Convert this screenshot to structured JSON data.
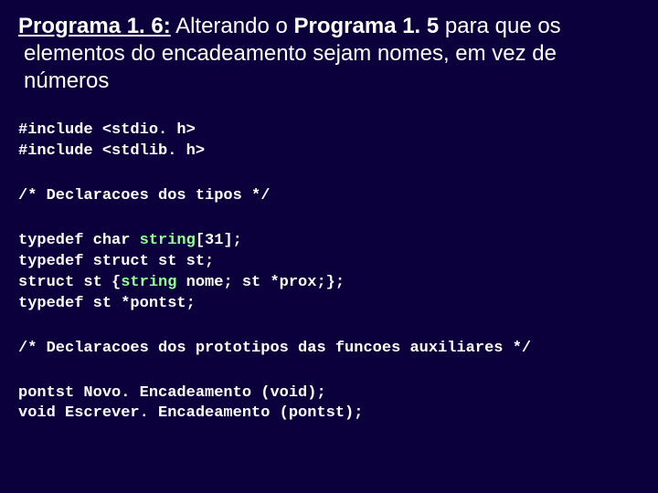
{
  "title": {
    "label": "Programa 1. 6:",
    "body_pre": " Alterando o ",
    "body_emph": "Programa 1. 5",
    "body_post": " para que os elementos do encadeamento sejam nomes, em vez de números"
  },
  "code": {
    "includes": {
      "l1": "#include <stdio. h>",
      "l2": "#include <stdlib. h>"
    },
    "comment_types": "/* Declaracoes dos tipos */",
    "types": {
      "l1_pre": "typedef char ",
      "l1_kw": "string",
      "l1_post": "[31];",
      "l2": "typedef struct st st;",
      "l3_pre": "struct st {",
      "l3_kw": "string",
      "l3_post": " nome; st *prox;};",
      "l4": "typedef st *pontst;"
    },
    "comment_protos": "/* Declaracoes dos prototipos das funcoes auxiliares */",
    "protos": {
      "l1": "pontst Novo. Encadeamento (void);",
      "l2": "void Escrever. Encadeamento (pontst);"
    }
  }
}
